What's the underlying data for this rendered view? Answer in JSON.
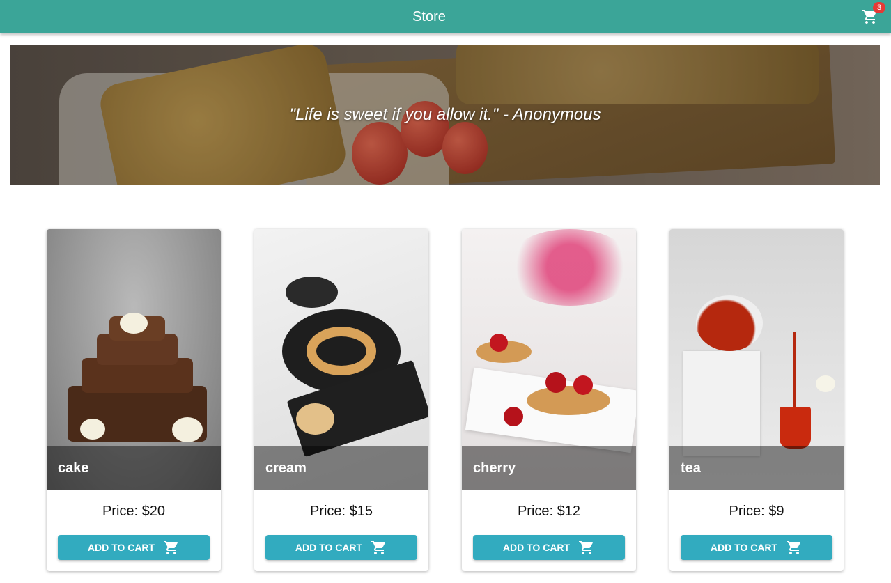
{
  "header": {
    "title": "Store",
    "cart_icon": "shopping-cart-icon",
    "cart_count": "3"
  },
  "hero": {
    "quote": "\"Life is sweet if you allow it.\" - Anonymous"
  },
  "products": [
    {
      "name": "cake",
      "price": "Price: $20",
      "button": "ADD TO CART"
    },
    {
      "name": "cream",
      "price": "Price: $15",
      "button": "ADD TO CART"
    },
    {
      "name": "cherry",
      "price": "Price: $12",
      "button": "ADD TO CART"
    },
    {
      "name": "tea",
      "price": "Price: $9",
      "button": "ADD TO CART"
    }
  ],
  "colors": {
    "appbar": "#3ba598",
    "button": "#32abbf",
    "badge": "#e53935"
  }
}
